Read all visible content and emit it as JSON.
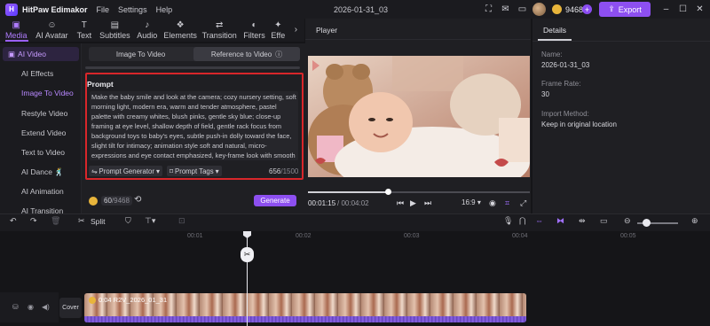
{
  "titlebar": {
    "app_name": "HitPaw Edimakor",
    "menus": [
      "File",
      "Settings",
      "Help"
    ],
    "doc_title": "2026-01-31_03",
    "credits": "9468",
    "export_label": "Export"
  },
  "tooltabs": [
    {
      "label": "Media",
      "icon": "media-icon",
      "active": true
    },
    {
      "label": "AI Avatar",
      "icon": "ai-avatar-icon"
    },
    {
      "label": "Text",
      "icon": "text-icon"
    },
    {
      "label": "Subtitles",
      "icon": "subtitles-icon"
    },
    {
      "label": "Audio",
      "icon": "audio-icon"
    },
    {
      "label": "Elements",
      "icon": "elements-icon"
    },
    {
      "label": "Transition",
      "icon": "transition-icon"
    },
    {
      "label": "Filters",
      "icon": "filters-icon"
    },
    {
      "label": "Effe",
      "icon": "effects-icon"
    }
  ],
  "sidebar": {
    "section": "AI Video",
    "items": [
      "AI Effects",
      "Image To Video",
      "Restyle Video",
      "Extend Video",
      "Text to Video",
      "AI Dance",
      "AI Animation",
      "AI Transition"
    ],
    "active": "Image To Video"
  },
  "panel": {
    "seg_left": "Image To Video",
    "seg_right": "Reference to Video",
    "prompt_label": "Prompt",
    "prompt_text": "Make the baby smile and look at the camera; cozy nursery setting, soft morning light, modern era, warm and tender atmosphere, pastel palette with creamy whites, blush pinks, gentle sky blue; close-up framing at eye level, shallow depth of field, gentle rack focus from background toys to baby’s eyes, subtle push-in dolly toward the face, slight tilt for intimacy; animation style soft and natural, micro-expressions and eye contact emphasized, key-frame look with smooth easing, delicate facial squash-and-stretch;",
    "prompt_generator": "Prompt Generator",
    "prompt_tags": "Prompt Tags",
    "char_count": "656",
    "char_max": "/1500",
    "credit_used": "60",
    "credit_total": "/9468",
    "generate_label": "Generate"
  },
  "player": {
    "title": "Player",
    "time_current": "00:01:15",
    "time_total": "/ 00:04:02",
    "aspect": "16:9",
    "progress": 0.36
  },
  "details": {
    "tab": "Details",
    "name_label": "Name:",
    "name_value": "2026-01-31_03",
    "frame_label": "Frame Rate:",
    "frame_value": "30",
    "import_label": "Import Method:",
    "import_value": "Keep in original location"
  },
  "timeline": {
    "split_label": "Split",
    "ruler": [
      "00:01",
      "00:02",
      "00:03",
      "00:04",
      "00:05"
    ],
    "cover_label": "Cover",
    "clip_label": "0:04 R2V_2026_01_31"
  }
}
